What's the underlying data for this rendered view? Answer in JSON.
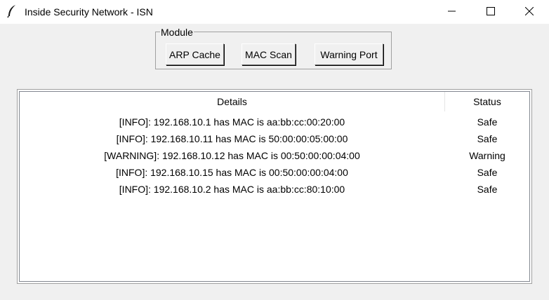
{
  "window": {
    "title": "Inside Security Network - ISN",
    "icon": "feather-icon",
    "controls": [
      "minimize-icon",
      "maximize-icon",
      "close-icon"
    ]
  },
  "module": {
    "label": "Module",
    "buttons": [
      "ARP Cache",
      "MAC Scan",
      "Warning Port"
    ]
  },
  "table": {
    "columns": [
      "Details",
      "Status"
    ],
    "rows": [
      {
        "details": "[INFO]: 192.168.10.1 has MAC is aa:bb:cc:00:20:00",
        "status": "Safe"
      },
      {
        "details": "[INFO]: 192.168.10.11 has MAC is 50:00:00:05:00:00",
        "status": "Safe"
      },
      {
        "details": "[WARNING]: 192.168.10.12 has MAC is 00:50:00:00:04:00",
        "status": "Warning"
      },
      {
        "details": "[INFO]: 192.168.10.15 has MAC is 00:50:00:00:04:00",
        "status": "Safe"
      },
      {
        "details": "[INFO]: 192.168.10.2 has MAC is aa:bb:cc:80:10:00",
        "status": "Safe"
      }
    ]
  }
}
